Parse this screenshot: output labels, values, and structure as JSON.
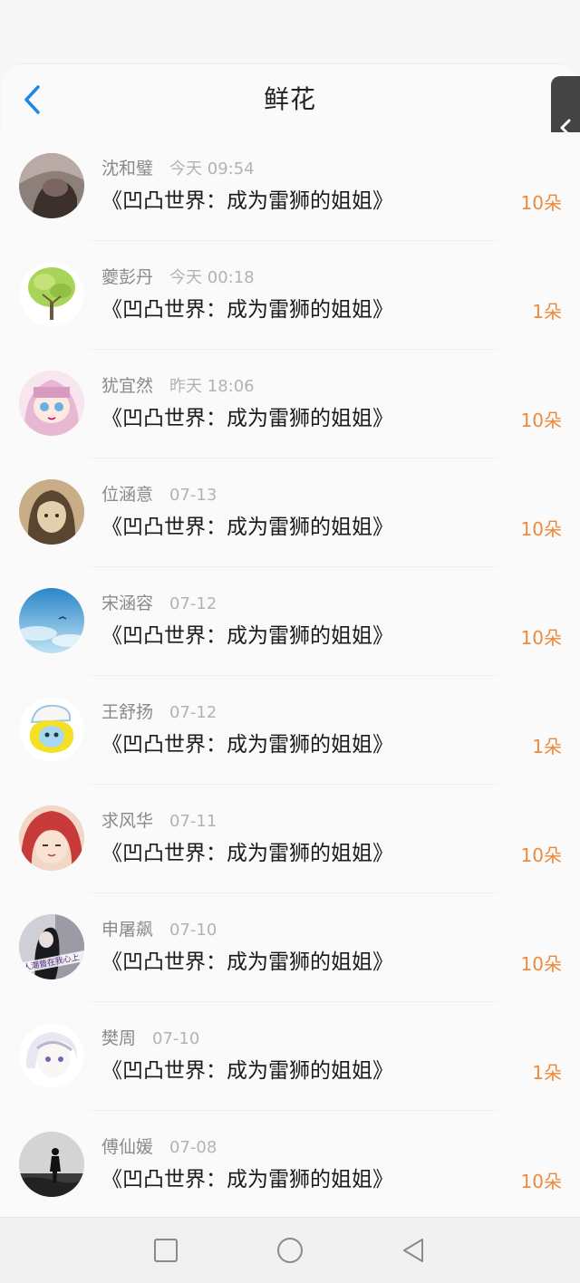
{
  "header": {
    "title": "鲜花"
  },
  "icons": {
    "back": "chevron-left-icon",
    "side": "chevron-left-icon"
  },
  "colors": {
    "accent": "#1e88e5",
    "count": "#ef8a3c"
  },
  "items": [
    {
      "name": "沈和璧",
      "time": "今天 09:54",
      "book": "《凹凸世界：成为雷狮的姐姐》",
      "count": "10朵"
    },
    {
      "name": "夔彭丹",
      "time": "今天 00:18",
      "book": "《凹凸世界：成为雷狮的姐姐》",
      "count": "1朵"
    },
    {
      "name": "犹宜然",
      "time": "昨天 18:06",
      "book": "《凹凸世界：成为雷狮的姐姐》",
      "count": "10朵"
    },
    {
      "name": "位涵意",
      "time": "07-13",
      "book": "《凹凸世界：成为雷狮的姐姐》",
      "count": "10朵"
    },
    {
      "name": "宋涵容",
      "time": "07-12",
      "book": "《凹凸世界：成为雷狮的姐姐》",
      "count": "10朵"
    },
    {
      "name": "王舒扬",
      "time": "07-12",
      "book": "《凹凸世界：成为雷狮的姐姐》",
      "count": "1朵"
    },
    {
      "name": "求风华",
      "time": "07-11",
      "book": "《凹凸世界：成为雷狮的姐姐》",
      "count": "10朵"
    },
    {
      "name": "申屠飙",
      "time": "07-10",
      "book": "《凹凸世界：成为雷狮的姐姐》",
      "count": "10朵"
    },
    {
      "name": "樊周",
      "time": "07-10",
      "book": "《凹凸世界：成为雷狮的姐姐》",
      "count": "1朵"
    },
    {
      "name": "傅仙媛",
      "time": "07-08",
      "book": "《凹凸世界：成为雷狮的姐姐》",
      "count": "10朵"
    }
  ],
  "avatar_text": "人潮曾在我心上",
  "navbar": {
    "icons": [
      "square-icon",
      "circle-icon",
      "triangle-back-icon"
    ]
  }
}
